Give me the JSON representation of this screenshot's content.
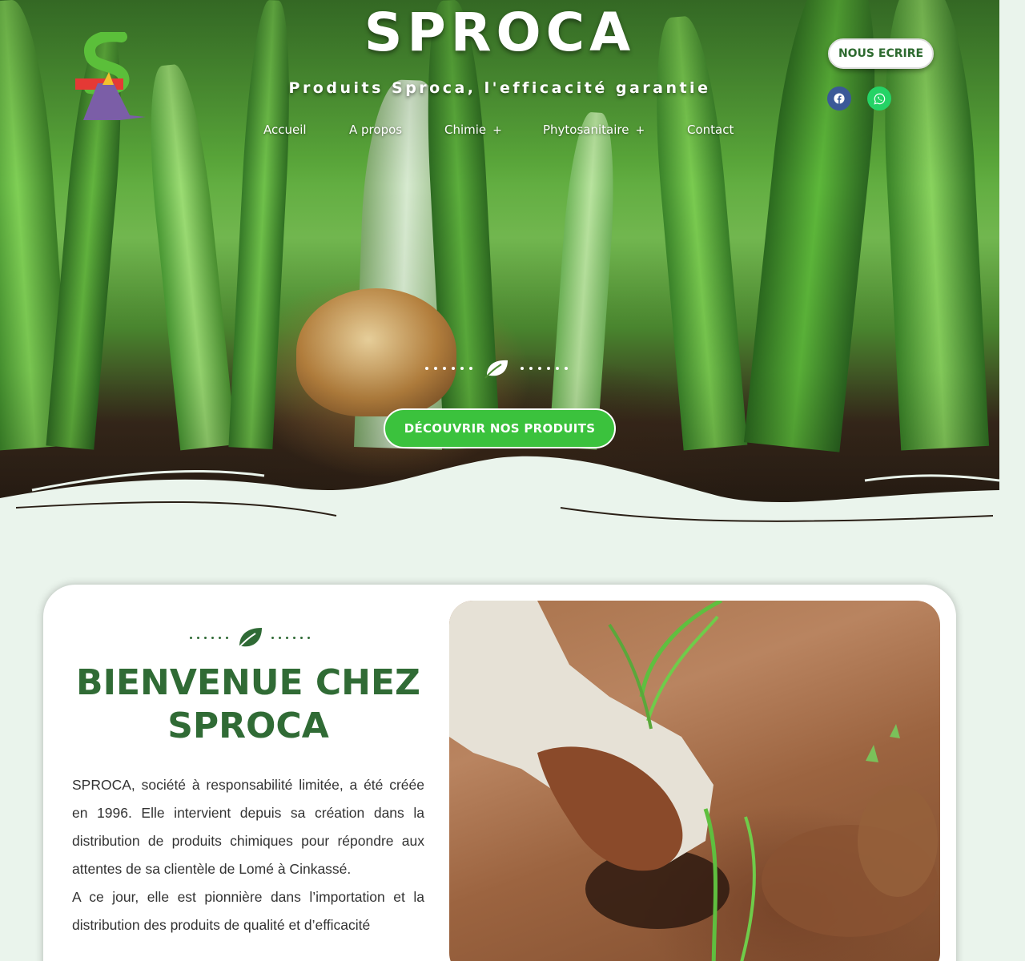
{
  "header": {
    "site_title": "SPROCA",
    "tagline": "Produits Sproca, l'efficacité garantie",
    "write_button": "NOUS ECRIRE",
    "social": [
      "facebook-icon",
      "whatsapp-icon"
    ]
  },
  "nav": {
    "items": [
      {
        "label": "Accueil"
      },
      {
        "label": "A propos"
      },
      {
        "label": "Chimie",
        "submenu": "+"
      },
      {
        "label": "Phytosanitaire",
        "submenu": "+"
      },
      {
        "label": "Contact"
      }
    ]
  },
  "hero": {
    "cta": "DÉCOUVRIR NOS PRODUITS"
  },
  "about": {
    "title_line1": "BIENVENUE CHEZ",
    "title_line2": "SPROCA",
    "paragraph1": "SPROCA, société à responsabilité limitée, a été créée en 1996. Elle intervient depuis sa création dans la distribution de produits chimiques pour répondre aux attentes de sa clientèle de Lomé à Cinkassé.",
    "paragraph2": "A ce jour, elle est pionnière dans l’importation et la distribution des produits de qualité et d’efficacité"
  },
  "colors": {
    "accent_green": "#3bc23d",
    "title_green": "#306b35",
    "page_background": "#eaf4ec",
    "facebook": "#3b5998",
    "whatsapp": "#25d366"
  }
}
